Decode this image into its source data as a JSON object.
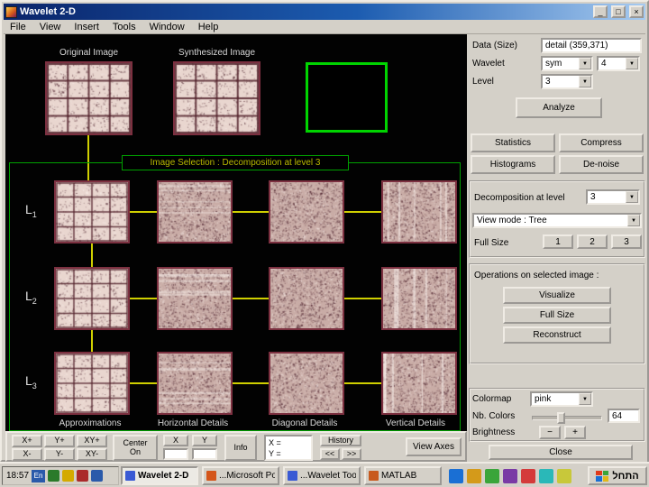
{
  "window": {
    "title": "Wavelet 2-D",
    "menu": [
      "File",
      "View",
      "Insert",
      "Tools",
      "Window",
      "Help"
    ]
  },
  "icons": {
    "minimize": "_",
    "maximize": "□",
    "close": "×",
    "dropdown_arrow": "▼"
  },
  "viewer": {
    "original_label": "Original Image",
    "synthesized_label": "Synthesized Image",
    "selection_text": "Image Selection : Decomposition at level 3",
    "rows": [
      {
        "base": "L",
        "sub": "1"
      },
      {
        "base": "L",
        "sub": "2"
      },
      {
        "base": "L",
        "sub": "3"
      }
    ],
    "column_labels": [
      "Approximations",
      "Horizontal Details",
      "Diagonal Details",
      "Vertical Details"
    ]
  },
  "panel": {
    "data_label": "Data  (Size)",
    "data_value": "detail  (359,371)",
    "wavelet_label": "Wavelet",
    "wavelet_family": "sym",
    "wavelet_order": "4",
    "level_label": "Level",
    "level_value": "3",
    "analyze": "Analyze",
    "statistics": "Statistics",
    "compress": "Compress",
    "histograms": "Histograms",
    "denoise": "De-noise",
    "decomposition_label": "Decomposition at level",
    "decomposition_value": "3",
    "view_mode": "View mode : Tree",
    "full_size_label": "Full Size",
    "full_size_options": [
      "1",
      "2",
      "3"
    ],
    "operations_label": "Operations on selected image :",
    "visualize": "Visualize",
    "full_size_button": "Full Size",
    "reconstruct": "Reconstruct",
    "colormap_label": "Colormap",
    "colormap_value": "pink",
    "nb_colors_label": "Nb. Colors",
    "nb_colors_value": "64",
    "brightness_label": "Brightness",
    "brightness_minus": "−",
    "brightness_plus": "+",
    "close": "Close"
  },
  "toolbar": {
    "zoom": [
      "X+",
      "Y+",
      "XY+",
      "X-",
      "Y-",
      "XY-"
    ],
    "center_on": "Center On",
    "x_label": "X",
    "y_label": "Y",
    "info": "Info",
    "pos_x": "X =",
    "pos_y": "Y =",
    "history": "History",
    "back": "<<",
    "forward": ">>",
    "view_axes": "View Axes"
  },
  "taskbar": {
    "clock": "18:57",
    "language": "En",
    "tasks": [
      {
        "label": "Wavelet 2-D",
        "active": true
      },
      {
        "label": "...Microsoft Po",
        "active": false
      },
      {
        "label": "...Wavelet Too",
        "active": false
      },
      {
        "label": "MATLAB",
        "active": false
      }
    ],
    "start": "התחל"
  },
  "colors": {
    "title_gradient_left": "#0a246a",
    "title_gradient_right": "#a6caf0",
    "chrome": "#d4d0c8",
    "canvas_bg": "#020202",
    "selection_green": "#00d400",
    "tree_yellow": "#cfcf00",
    "thumb_border": "#7c3040"
  }
}
